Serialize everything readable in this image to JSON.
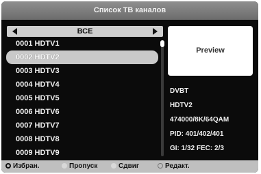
{
  "title": "Список ТВ каналов",
  "selector": {
    "label": "ВСЕ"
  },
  "channels": [
    "0001 HDTV1",
    "0002 HDTV2",
    "0003 HDTV3",
    "0004 HDTV4",
    "0005 HDTV5",
    "0006 HDTV6",
    "0007 HDTV7",
    "0008 HDTV8",
    "0009 HDTV9"
  ],
  "selected_index": 1,
  "preview": {
    "label": "Preview"
  },
  "info": {
    "type": "DVBT",
    "name": "HDTV2",
    "tuning": "474000/8K/64QAM",
    "pid": "PID: 401/402/401",
    "gi_fec": "GI: 1/32 FEC: 2/3"
  },
  "footer": {
    "favorites": "Избран.",
    "skip": "Пропуск",
    "move": "Сдвиг",
    "edit": "Редакт."
  }
}
